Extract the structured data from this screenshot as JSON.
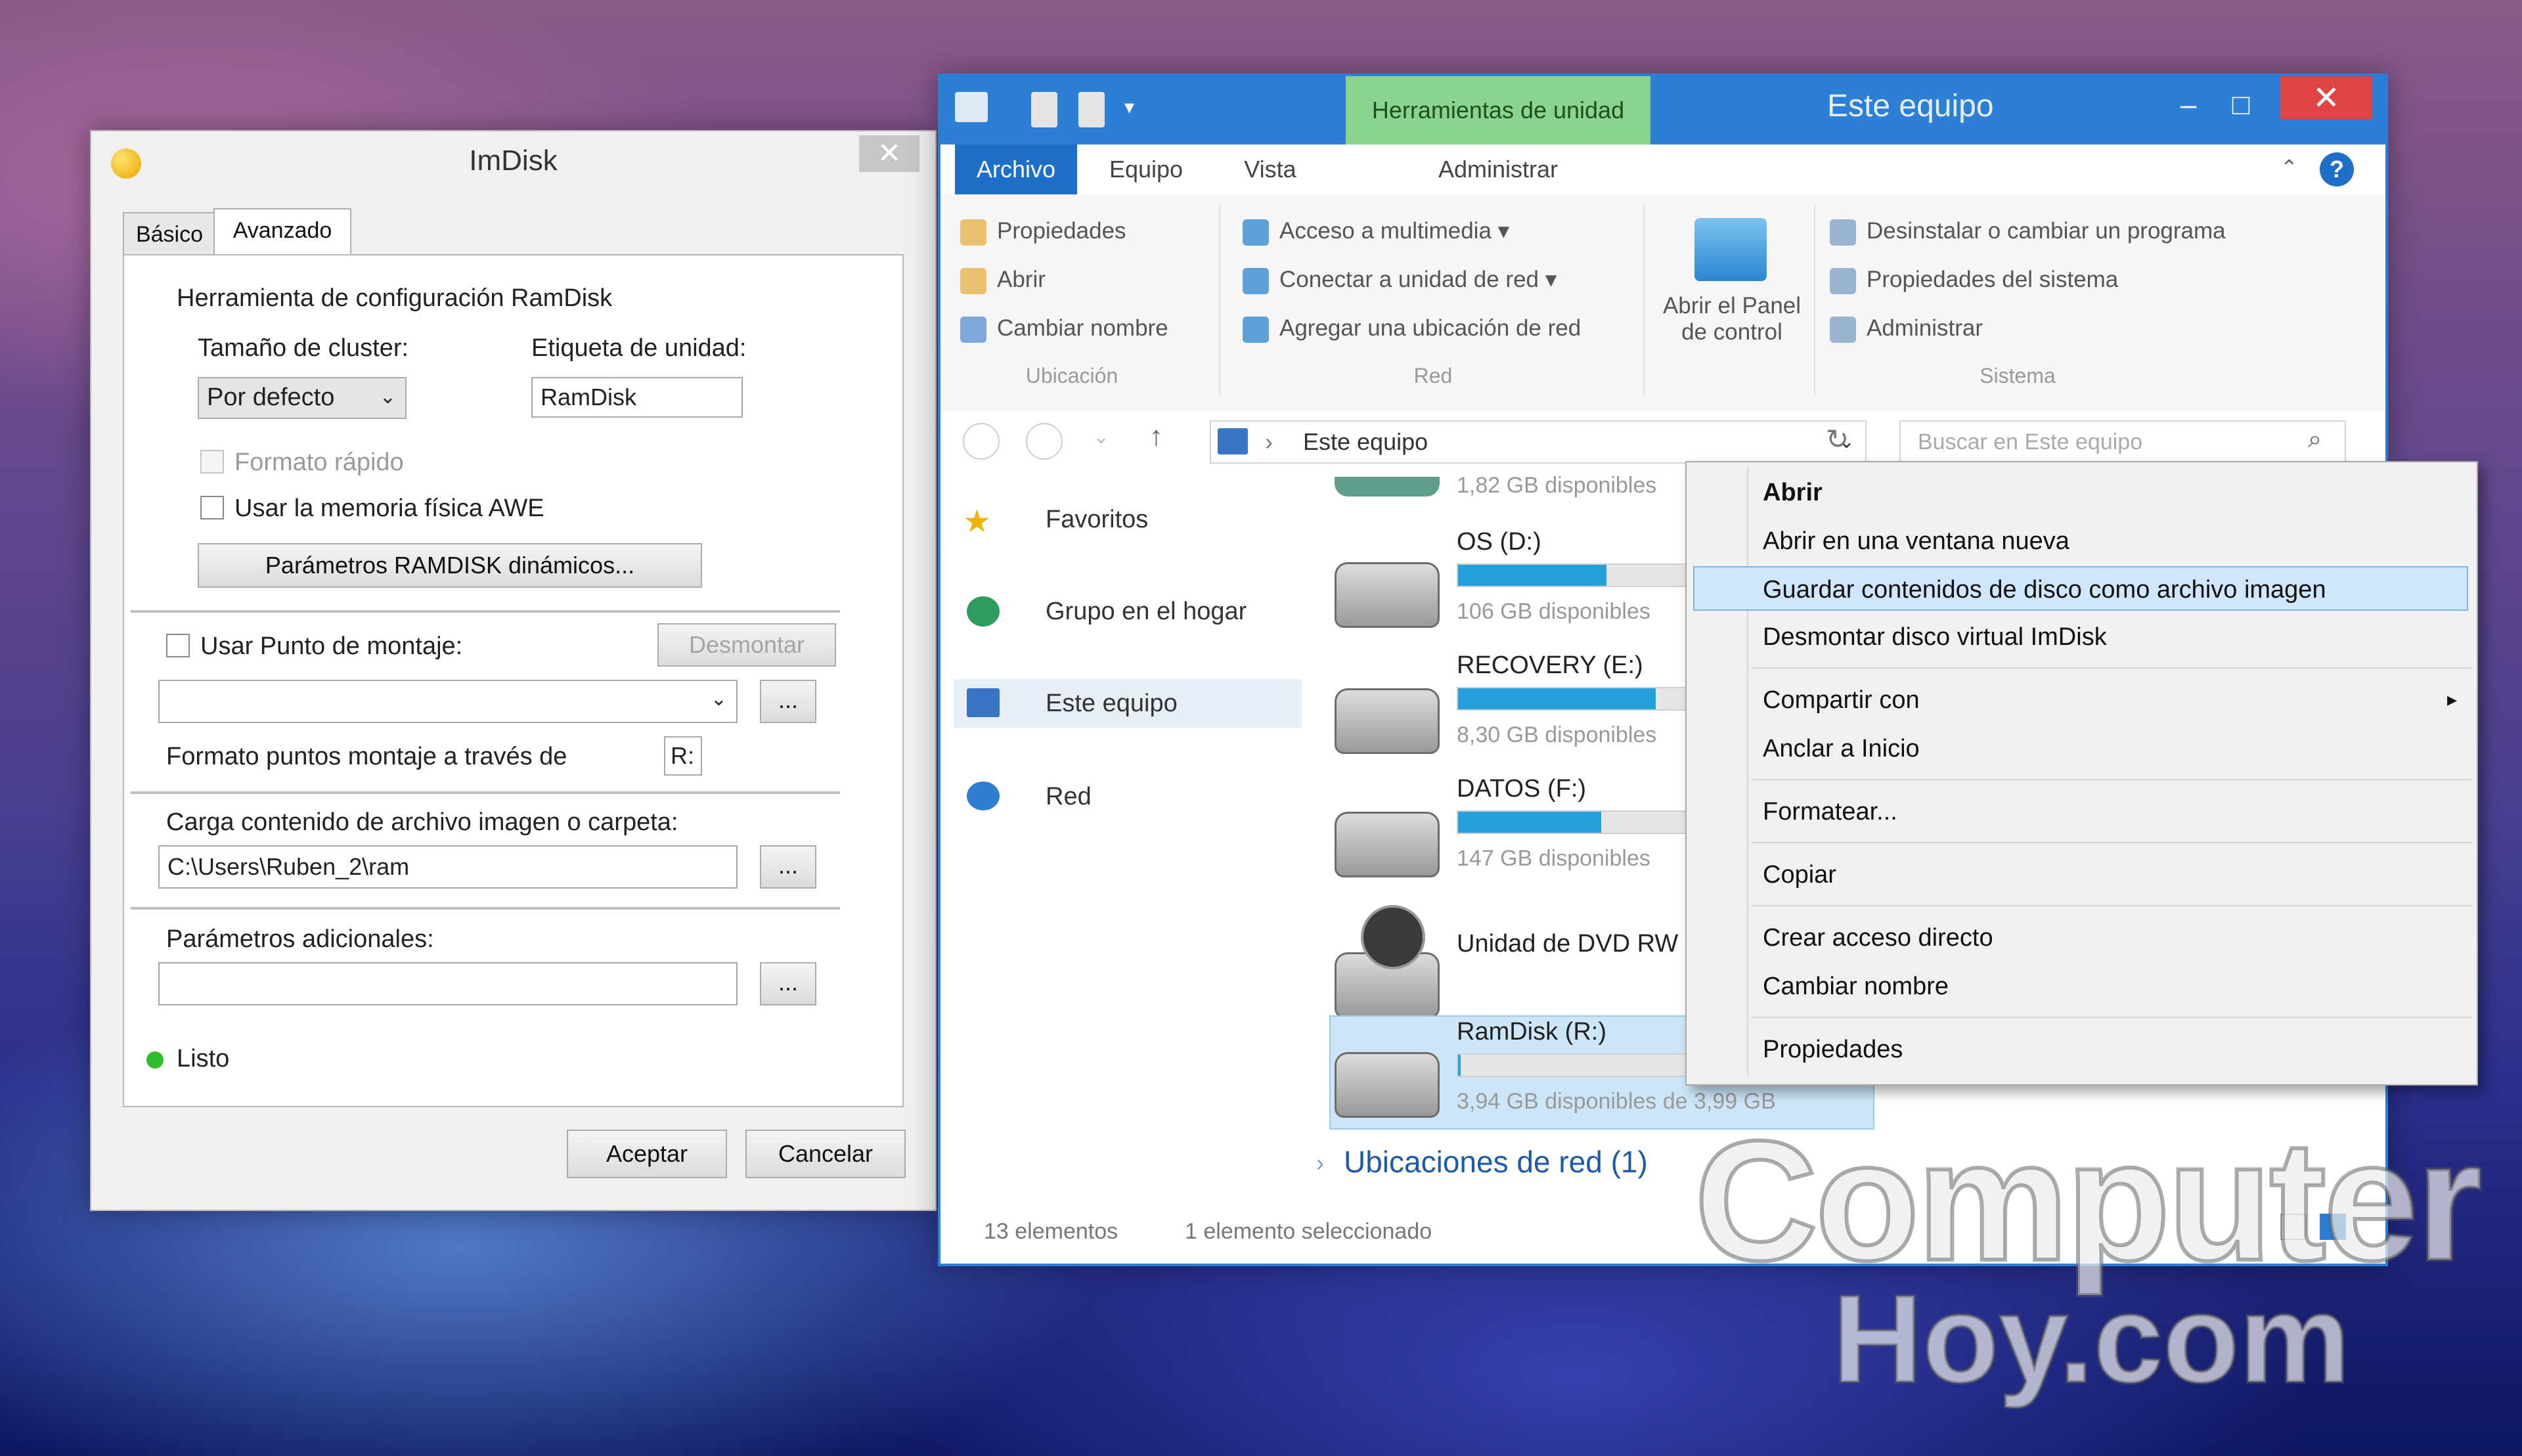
{
  "imdisk": {
    "title": "ImDisk",
    "close": "✕",
    "tabs": [
      "Básico",
      "Avanzado"
    ],
    "group_title": "Herramienta de configuración RamDisk",
    "cluster_label": "Tamaño de cluster:",
    "cluster_value": "Por defecto",
    "drive_label_label": "Etiqueta de unidad:",
    "drive_label_value": "RamDisk",
    "quick_format": "Formato rápido",
    "awe": "Usar la memoria física AWE",
    "dynamic_button": "Parámetros RAMDISK dinámicos...",
    "mount_point": "Usar Punto de montaje:",
    "unmount_button": "Desmontar",
    "browse": "...",
    "format_via": "Formato puntos montaje a través de",
    "format_letter": "R:",
    "load_label": "Carga contenido de archivo imagen o carpeta:",
    "load_value": "C:\\Users\\Ruben_2\\ram",
    "extra_label": "Parámetros adicionales:",
    "status": "Listo",
    "ok": "Aceptar",
    "cancel": "Cancelar"
  },
  "explorer": {
    "tools_tab": "Herramientas de unidad",
    "title": "Este equipo",
    "ribbon_tabs": [
      "Archivo",
      "Equipo",
      "Vista",
      "Administrar"
    ],
    "help": "?",
    "ubicacion": {
      "items": [
        "Propiedades",
        "Abrir",
        "Cambiar nombre"
      ],
      "group": "Ubicación"
    },
    "red": {
      "items": [
        "Acceso a multimedia ▾",
        "Conectar a unidad de red ▾",
        "Agregar una ubicación de red"
      ],
      "group": "Red"
    },
    "panel": {
      "line1": "Abrir el Panel",
      "line2": "de control"
    },
    "sistema": {
      "items": [
        "Desinstalar o cambiar un programa",
        "Propiedades del sistema",
        "Administrar"
      ],
      "group": "Sistema"
    },
    "address": "Este equipo",
    "search_placeholder": "Buscar en Este equipo",
    "nav": [
      "Favoritos",
      "Grupo en el hogar",
      "Este equipo",
      "Red"
    ],
    "drives": [
      {
        "free": "1,82 GB disponibles"
      },
      {
        "name": "OS (D:)",
        "free": "106 GB disponibles",
        "used_fraction": 0.6
      },
      {
        "name": "RECOVERY (E:)",
        "free": "8,30 GB disponibles",
        "used_fraction": 0.8
      },
      {
        "name": "DATOS (F:)",
        "free": "147 GB disponibles",
        "used_fraction": 0.58
      },
      {
        "name": "Unidad de DVD RW"
      },
      {
        "name": "RamDisk (R:)",
        "free": "3,94 GB disponibles de 3,99 GB",
        "used_fraction": 0.01
      }
    ],
    "network_locations": "Ubicaciones de red (1)",
    "status_count": "13 elementos",
    "status_selected": "1 elemento seleccionado"
  },
  "context_menu": [
    {
      "label": "Abrir",
      "bold": true
    },
    {
      "label": "Abrir en una ventana nueva"
    },
    {
      "label": "Guardar contenidos de disco como archivo imagen",
      "highlight": true
    },
    {
      "label": "Desmontar disco virtual ImDisk"
    },
    {
      "label": "Compartir con",
      "submenu": true
    },
    {
      "label": "Anclar a Inicio"
    },
    {
      "label": "Formatear..."
    },
    {
      "label": "Copiar"
    },
    {
      "label": "Crear acceso directo"
    },
    {
      "label": "Cambiar nombre"
    },
    {
      "label": "Propiedades"
    }
  ],
  "submenu_arrow": "▸",
  "watermark": {
    "line1": "Computer",
    "line2": "Hoy.com"
  },
  "colors": {
    "accent": "#2d7fd5",
    "progress": "#26a0da",
    "tools_tab": "#8ad48f",
    "close": "#e04343",
    "status_ok": "#2dbd2d"
  }
}
